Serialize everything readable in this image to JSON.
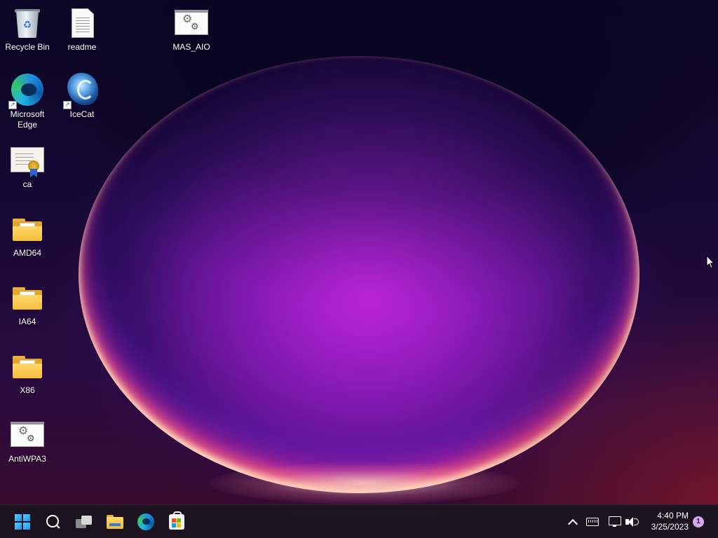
{
  "desktop": {
    "icons": [
      {
        "id": "recycle-bin",
        "label": "Recycle Bin"
      },
      {
        "id": "readme",
        "label": "readme"
      },
      {
        "id": "mas-aio",
        "label": "MAS_AIO"
      },
      {
        "id": "microsoft-edge",
        "label": "Microsoft Edge"
      },
      {
        "id": "icecat",
        "label": "IceCat"
      },
      {
        "id": "ca",
        "label": "ca"
      },
      {
        "id": "amd64",
        "label": "AMD64"
      },
      {
        "id": "ia64",
        "label": "IA64"
      },
      {
        "id": "x86",
        "label": "X86"
      },
      {
        "id": "antiwpa3",
        "label": "AntiWPA3"
      }
    ]
  },
  "taskbar": {
    "pinned": [
      {
        "name": "Start",
        "icon": "windows-logo-icon"
      },
      {
        "name": "Search",
        "icon": "search-icon"
      },
      {
        "name": "Task View",
        "icon": "task-view-icon"
      },
      {
        "name": "File Explorer",
        "icon": "folder-icon"
      },
      {
        "name": "Microsoft Edge",
        "icon": "edge-icon"
      },
      {
        "name": "Microsoft Store",
        "icon": "store-icon"
      }
    ],
    "tray": {
      "time": "4:40 PM",
      "date": "3/25/2023",
      "notification_count": "1"
    }
  },
  "colors": {
    "taskbar_bg": "#1c1420",
    "accent": "#1f8fe8",
    "notification_badge": "#d7a7f0"
  }
}
